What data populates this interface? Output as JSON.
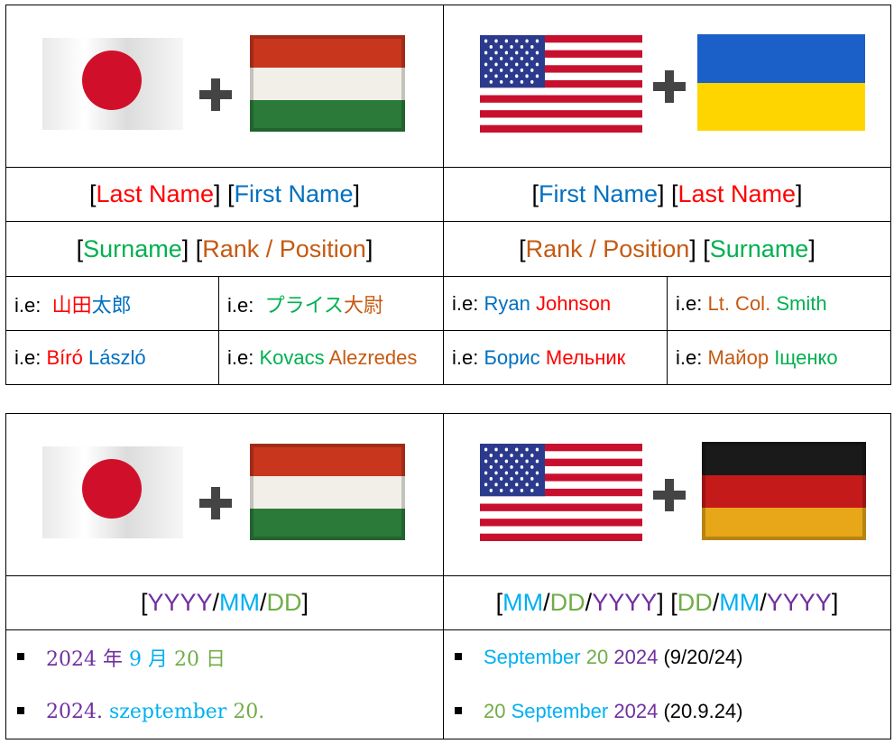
{
  "colors": {
    "red": "#ff0000",
    "blue": "#0070c0",
    "green": "#00b050",
    "orange": "#c55a11",
    "purple": "#7030a0",
    "cyan": "#00b0f0",
    "lightgreen": "#70ad47"
  },
  "icons": [
    "japan-flag-icon",
    "hungary-flag-icon",
    "usa-flag-icon",
    "ukraine-flag-icon",
    "germany-flag-icon",
    "plus-icon"
  ],
  "names": {
    "left_header1": {
      "b1": "[",
      "last": "Last Name",
      "mid": "] [",
      "first": "First Name",
      "b2": "]"
    },
    "right_header1": {
      "b1": "[",
      "first": "First Name",
      "mid": "] [",
      "last": "Last Name",
      "b2": "]"
    },
    "left_header2": {
      "b1": "[",
      "surname": "Surname",
      "mid": "] [",
      "rank": "Rank / Position",
      "b2": "]"
    },
    "right_header2": {
      "b1": "[",
      "rank": "Rank / Position",
      "mid": "] [",
      "surname": "Surname",
      "b2": "]"
    },
    "prefix": "i.e:",
    "ex_jp_name": {
      "last": "山田",
      "first": "太郎"
    },
    "ex_jp_rank": {
      "surname": "プライス",
      "rank": "大尉"
    },
    "ex_us_name": {
      "first": "Ryan",
      "last": "Johnson"
    },
    "ex_us_rank": {
      "rank": "Lt. Col.",
      "surname": "Smith"
    },
    "ex_hu_name": {
      "last": "Bíró",
      "first": "László"
    },
    "ex_hu_rank": {
      "surname": "Kovacs",
      "rank": "Alezredes"
    },
    "ex_ua_name": {
      "first": "Борис",
      "last": "Мельник"
    },
    "ex_ua_rank": {
      "rank": "Майор",
      "surname": "Іщенко"
    }
  },
  "dates": {
    "left_header": {
      "b1": "[",
      "yyyy": "YYYY",
      "s1": "/",
      "mm": "MM",
      "s2": "/",
      "dd": "DD",
      "b2": "]"
    },
    "right_header": {
      "b1": "[",
      "mm1": "MM",
      "s1": "/",
      "dd1": "DD",
      "s2": "/",
      "yyyy1": "YYYY",
      "mid": "] [",
      "dd2": "DD",
      "s3": "/",
      "mm2": "MM",
      "s4": "/",
      "yyyy2": "YYYY",
      "b2": "]"
    },
    "jp_example": {
      "year": "2024",
      "year_k": "年",
      "month": "9",
      "month_k": "月",
      "day": "20",
      "day_k": "日"
    },
    "hu_example": {
      "year": "2024.",
      "month": "szeptember",
      "day": "20."
    },
    "us_example": {
      "month": "September",
      "day": "20",
      "year": "2024",
      "short": "(9/20/24)"
    },
    "de_example": {
      "day": "20",
      "month": "September",
      "year": "2024",
      "short": "(20.9.24)"
    }
  }
}
